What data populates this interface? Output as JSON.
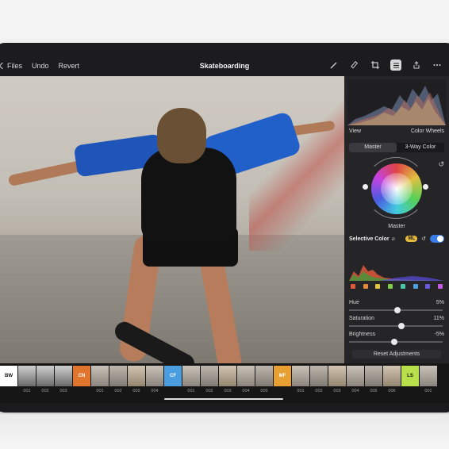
{
  "toolbar": {
    "back_label": "Files",
    "undo_label": "Undo",
    "revert_label": "Revert",
    "title": "Skateboarding"
  },
  "panel": {
    "view_label": "View",
    "view_value": "Color Wheels",
    "segments": [
      "Master",
      "3-Way Color"
    ],
    "wheel_label": "Master",
    "selective_color_label": "Selective Color",
    "ml_badge": "ML",
    "swatch_colors": [
      "#e05a3a",
      "#e08a3a",
      "#e0c43a",
      "#7fcc45",
      "#45c8a8",
      "#4aa0e0",
      "#6a5ae0",
      "#c05ae0"
    ],
    "sliders": [
      {
        "label": "Hue",
        "value": "5%",
        "level": 0.52
      },
      {
        "label": "Saturation",
        "value": "11%",
        "level": 0.56
      },
      {
        "label": "Brightness",
        "value": "-5%",
        "level": 0.48
      }
    ],
    "reset_label": "Reset Adjustments"
  },
  "filmstrip": {
    "groups": [
      {
        "tag": "BW",
        "color": "#ffffff",
        "tag_text_color": "#111",
        "labels": [
          "001",
          "002",
          "003"
        ]
      },
      {
        "tag": "CN",
        "color": "#e0752e",
        "tag_text_color": "#fff",
        "labels": [
          "001",
          "002",
          "003",
          "004"
        ]
      },
      {
        "tag": "CF",
        "color": "#4a9ee0",
        "tag_text_color": "#fff",
        "labels": [
          "001",
          "002",
          "003",
          "004",
          "005"
        ]
      },
      {
        "tag": "MF",
        "color": "#e8a033",
        "tag_text_color": "#fff",
        "labels": [
          "001",
          "002",
          "003",
          "004",
          "005",
          "006"
        ]
      },
      {
        "tag": "LS",
        "color": "#b8e04a",
        "tag_text_color": "#111",
        "labels": [
          "001"
        ]
      }
    ]
  }
}
